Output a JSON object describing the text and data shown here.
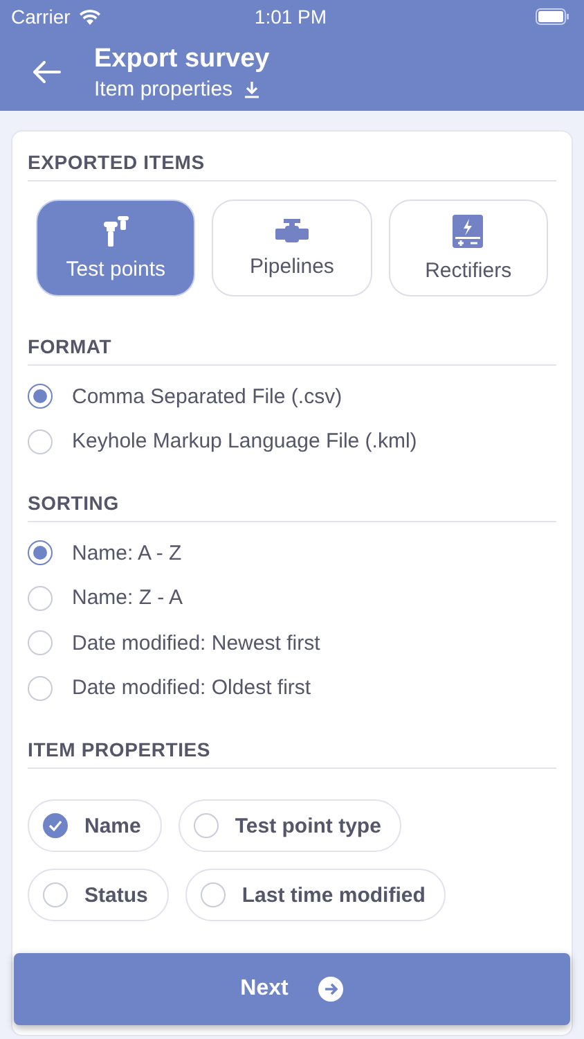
{
  "status_bar": {
    "carrier": "Carrier",
    "time": "1:01 PM"
  },
  "header": {
    "title": "Export survey",
    "subtitle": "Item properties"
  },
  "exported_items": {
    "title": "EXPORTED ITEMS",
    "items": [
      {
        "label": "Test points",
        "kind": "testpoint",
        "selected": true
      },
      {
        "label": "Pipelines",
        "kind": "pipeline",
        "selected": false
      },
      {
        "label": "Rectifiers",
        "kind": "rectifier",
        "selected": false
      }
    ]
  },
  "format": {
    "title": "FORMAT",
    "options": [
      {
        "label": "Comma Separated File (.csv)",
        "selected": true
      },
      {
        "label": "Keyhole Markup Language File (.kml)",
        "selected": false
      }
    ]
  },
  "sorting": {
    "title": "SORTING",
    "options": [
      {
        "label": "Name: A - Z",
        "selected": true
      },
      {
        "label": "Name: Z - A",
        "selected": false
      },
      {
        "label": "Date modified: Newest first",
        "selected": false
      },
      {
        "label": "Date modified: Oldest first",
        "selected": false
      }
    ]
  },
  "item_properties": {
    "title": "ITEM PROPERTIES",
    "rows": [
      [
        {
          "label": "Name",
          "checked": true
        },
        {
          "label": "Test point type",
          "checked": false
        }
      ],
      [
        {
          "label": "Status",
          "checked": false
        },
        {
          "label": "Last time modified",
          "checked": false
        }
      ]
    ]
  },
  "next_button": {
    "label": "Next"
  }
}
